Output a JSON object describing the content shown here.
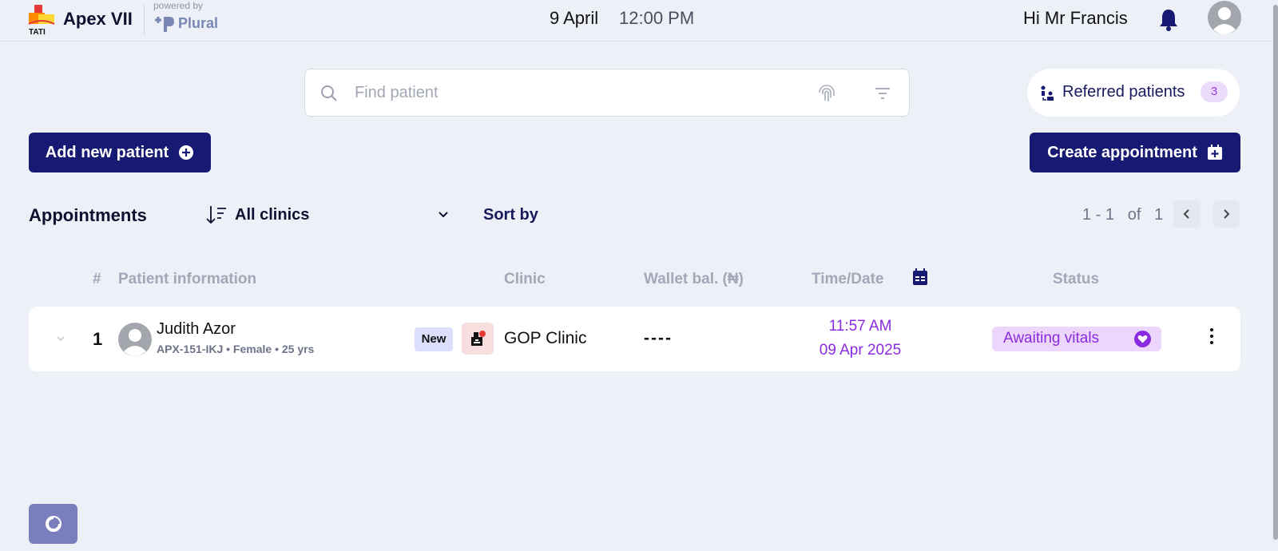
{
  "header": {
    "app_name": "Apex VII",
    "logo_text": "TATI",
    "powered_by": "powered by",
    "partner_name": "Plural",
    "date": "9 April",
    "time": "12:00 PM",
    "greeting": "Hi Mr Francis",
    "icons": [
      "bell-icon",
      "user-avatar-icon"
    ]
  },
  "search": {
    "placeholder": "Find patient",
    "value": "",
    "icons": [
      "search-icon",
      "fingerprint-icon",
      "filter-icon"
    ]
  },
  "referred": {
    "label": "Referred patients",
    "count": "3"
  },
  "actions": {
    "add_patient": "Add new patient",
    "create_appointment": "Create appointment"
  },
  "appointments": {
    "title": "Appointments",
    "clinic_filter": "All clinics",
    "sort_by": "Sort by",
    "pagination": {
      "range": "1 - 1",
      "of": "of",
      "total": "1"
    },
    "columns": {
      "num": "#",
      "patient": "Patient information",
      "clinic": "Clinic",
      "wallet": "Wallet bal. (₦)",
      "time": "Time/Date",
      "status": "Status"
    },
    "rows": [
      {
        "num": "1",
        "name": "Judith Azor",
        "meta": "APX-151-IKJ • Female • 25 yrs",
        "badge": "New",
        "clinic": "GOP Clinic",
        "wallet": "----",
        "time": "11:57 AM",
        "date": "09 Apr 2025",
        "status": "Awaiting vitals"
      }
    ]
  },
  "colors": {
    "primary": "#171a72",
    "accent_purple": "#8b2be0",
    "background": "#eef0f8",
    "status_pill": "#ecd6fb"
  }
}
